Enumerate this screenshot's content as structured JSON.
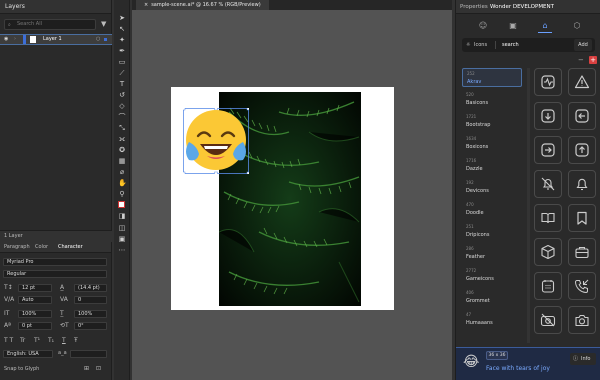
{
  "layers_panel": {
    "tab": "Layers",
    "search_placeholder": "Search All",
    "layer_name": "Layer 1",
    "footer": "1 Layer"
  },
  "character_panel": {
    "tabs": [
      "Paragraph",
      "Color",
      "Character"
    ],
    "font_family": "Myriad Pro",
    "font_style": "Regular",
    "font_size": "12 pt",
    "leading": "(14.4 pt)",
    "kerning": "Auto",
    "tracking": "0",
    "vscale": "100%",
    "hscale": "100%",
    "baseline": "0 pt",
    "rotation": "0°",
    "type_buttons": [
      "TT",
      "Tr",
      "T¹",
      "T₁",
      "T",
      "Ŧ"
    ],
    "language": "English: USA",
    "aa": "a_a",
    "snap": "Snap to Glyph"
  },
  "document": {
    "tab_title": "sample-scene.ai* @ 16.67 % (RGB/Preview)",
    "emoji": "😂"
  },
  "right_panel": {
    "tabs": [
      "Properties",
      "Wonder DEVELOPMENT"
    ],
    "iconbar": [
      "emoji-icon",
      "image-icon",
      "iconset-icon",
      "cube-icon"
    ],
    "search_mode": "Icons",
    "search_value": "search",
    "add_label": "Add",
    "libraries": [
      {
        "count": "252",
        "name": "Akrav"
      },
      {
        "count": "520",
        "name": "Basicons"
      },
      {
        "count": "1721",
        "name": "Bootstrap"
      },
      {
        "count": "1634",
        "name": "Boxicons"
      },
      {
        "count": "1716",
        "name": "Dazzle"
      },
      {
        "count": "192",
        "name": "Devicons"
      },
      {
        "count": "470",
        "name": "Doodle"
      },
      {
        "count": "251",
        "name": "Dripicons"
      },
      {
        "count": "286",
        "name": "Feather"
      },
      {
        "count": "2772",
        "name": "Gameicons"
      },
      {
        "count": "406",
        "name": "Grommet"
      },
      {
        "count": "47",
        "name": "Humaaans"
      }
    ],
    "icons": [
      "activity-square",
      "alert-triangle",
      "arrow-down-square",
      "arrow-left-square",
      "arrow-right-square",
      "arrow-up-square",
      "bell-off",
      "bell",
      "book-open",
      "bookmark",
      "box",
      "briefcase",
      "calendar",
      "call-incoming",
      "camera-off",
      "camera"
    ],
    "preview": {
      "size": "36 x 36",
      "info_label": "Info",
      "name": "Face with tears of joy"
    }
  }
}
